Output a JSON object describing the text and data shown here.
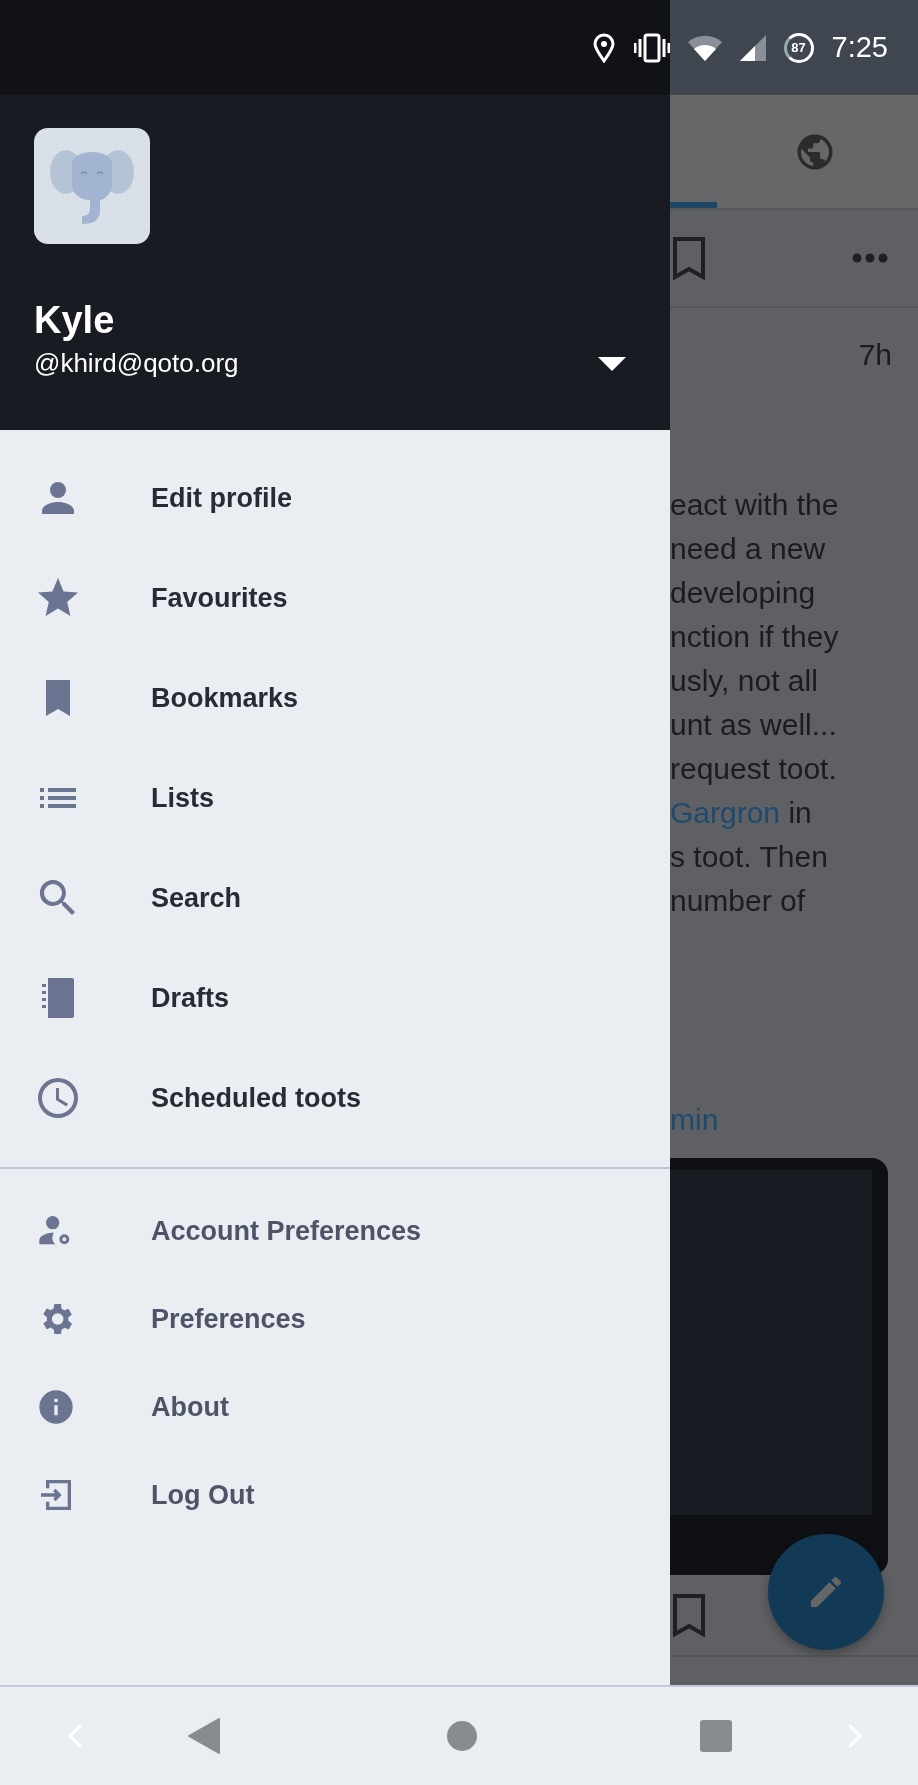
{
  "status_bar": {
    "battery": "87",
    "time": "7:25"
  },
  "drawer": {
    "account": {
      "display_name": "Kyle",
      "handle": "@khird@qoto.org"
    },
    "menu": [
      {
        "label": "Edit profile",
        "kind": "person"
      },
      {
        "label": "Favourites",
        "kind": "star"
      },
      {
        "label": "Bookmarks",
        "kind": "bookmark"
      },
      {
        "label": "Lists",
        "kind": "list"
      },
      {
        "label": "Search",
        "kind": "search"
      },
      {
        "label": "Drafts",
        "kind": "drafts"
      },
      {
        "label": "Scheduled toots",
        "kind": "clock"
      }
    ],
    "secondary_menu": [
      {
        "label": "Account Preferences",
        "kind": "account"
      },
      {
        "label": "Preferences",
        "kind": "gear"
      },
      {
        "label": "About",
        "kind": "info"
      },
      {
        "label": "Log Out",
        "kind": "logout"
      }
    ]
  },
  "background": {
    "timestamp": "7h",
    "post_lines": [
      [
        {
          "text": "eact with the",
          "link": false
        }
      ],
      [
        {
          "text": "need a new",
          "link": false
        }
      ],
      [
        {
          "text": "developing",
          "link": false
        }
      ],
      [
        {
          "text": "nction if they",
          "link": false
        }
      ],
      [
        {
          "text": "usly, not all",
          "link": false
        }
      ],
      [
        {
          "text": "unt as well...",
          "link": false
        }
      ],
      [
        {
          "text": "request toot.",
          "link": false
        }
      ],
      [
        {
          "text": "Gargron",
          "link": true
        },
        {
          "text": "in",
          "link": false
        }
      ],
      [
        {
          "text": "s toot. Then",
          "link": false
        }
      ],
      [
        {
          "text": "number of",
          "link": false
        }
      ]
    ],
    "link_line": "min"
  }
}
